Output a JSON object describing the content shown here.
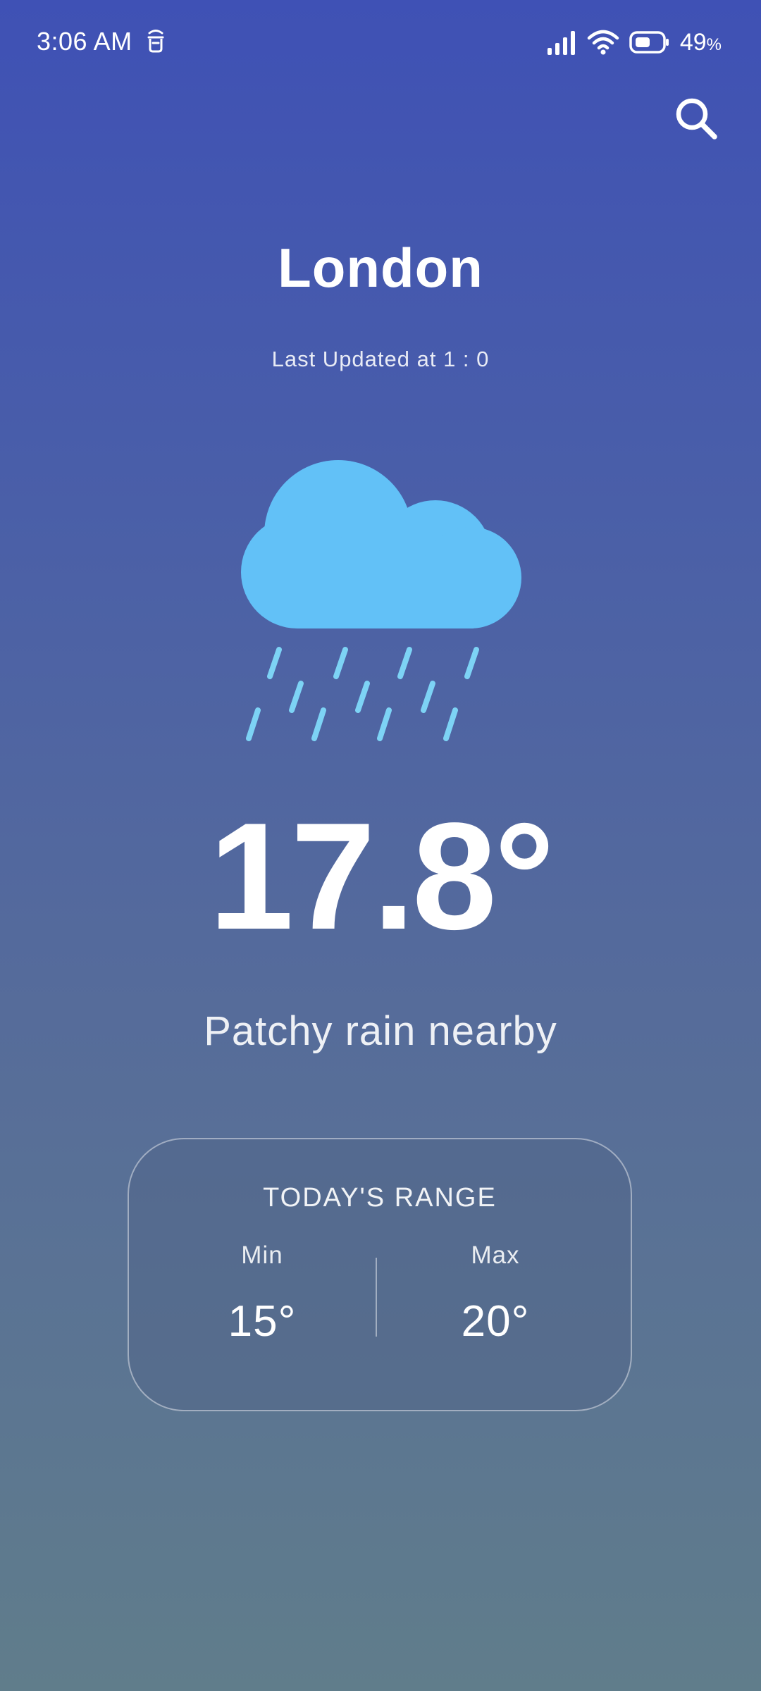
{
  "status_bar": {
    "time": "3:06 AM",
    "battery_percent": "49",
    "battery_unit": "%",
    "icons": [
      "notification-icon",
      "signal-icon",
      "wifi-icon",
      "battery-icon"
    ]
  },
  "header": {
    "city": "London",
    "last_updated": "Last Updated at 1 : 0"
  },
  "weather": {
    "icon": "rain-cloud-icon",
    "temperature": "17.8°",
    "condition": "Patchy rain nearby"
  },
  "range": {
    "title": "TODAY'S RANGE",
    "min_label": "Min",
    "min_value": "15°",
    "max_label": "Max",
    "max_value": "20°"
  },
  "colors": {
    "gradient_top": "#3f51b5",
    "gradient_bottom": "#607d8b",
    "cloud": "#62c1f7",
    "rain": "#7dd3f5"
  }
}
